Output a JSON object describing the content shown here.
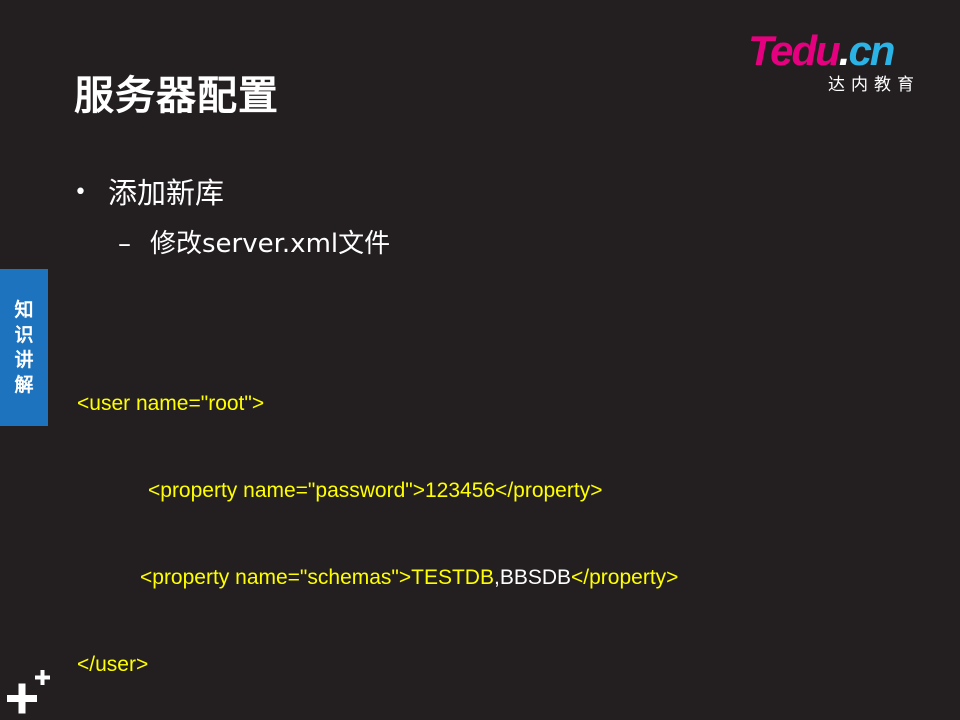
{
  "slide": {
    "title": "服务器配置",
    "logo": {
      "t": "T",
      "edu": "edu",
      "dot": ".",
      "cn": "cn",
      "subtitle": "达内教育"
    },
    "bullet": {
      "marker": "•",
      "text": "添加新库"
    },
    "sub_bullet": {
      "marker": "–",
      "text": "修改server.xml文件"
    },
    "side_tab": [
      "知",
      "识",
      "讲",
      "解"
    ],
    "code": {
      "line1": "<user name=\"root\">",
      "line2": "<property name=\"password\">123456</property>",
      "line3_open": "<property name=\"schemas\">",
      "line3_value_a": "TESTDB",
      "line3_comma": ",",
      "line3_value_b": "BBSDB",
      "line3_close": "</property>",
      "line4": "</user>"
    },
    "colors": {
      "background": "#231f20",
      "code_text": "#ffff00",
      "side_tab": "#1e73be",
      "logo_pink": "#e4007f",
      "logo_blue": "#2bb3e6"
    },
    "icons": {
      "corner": "plus-cluster-icon"
    }
  }
}
